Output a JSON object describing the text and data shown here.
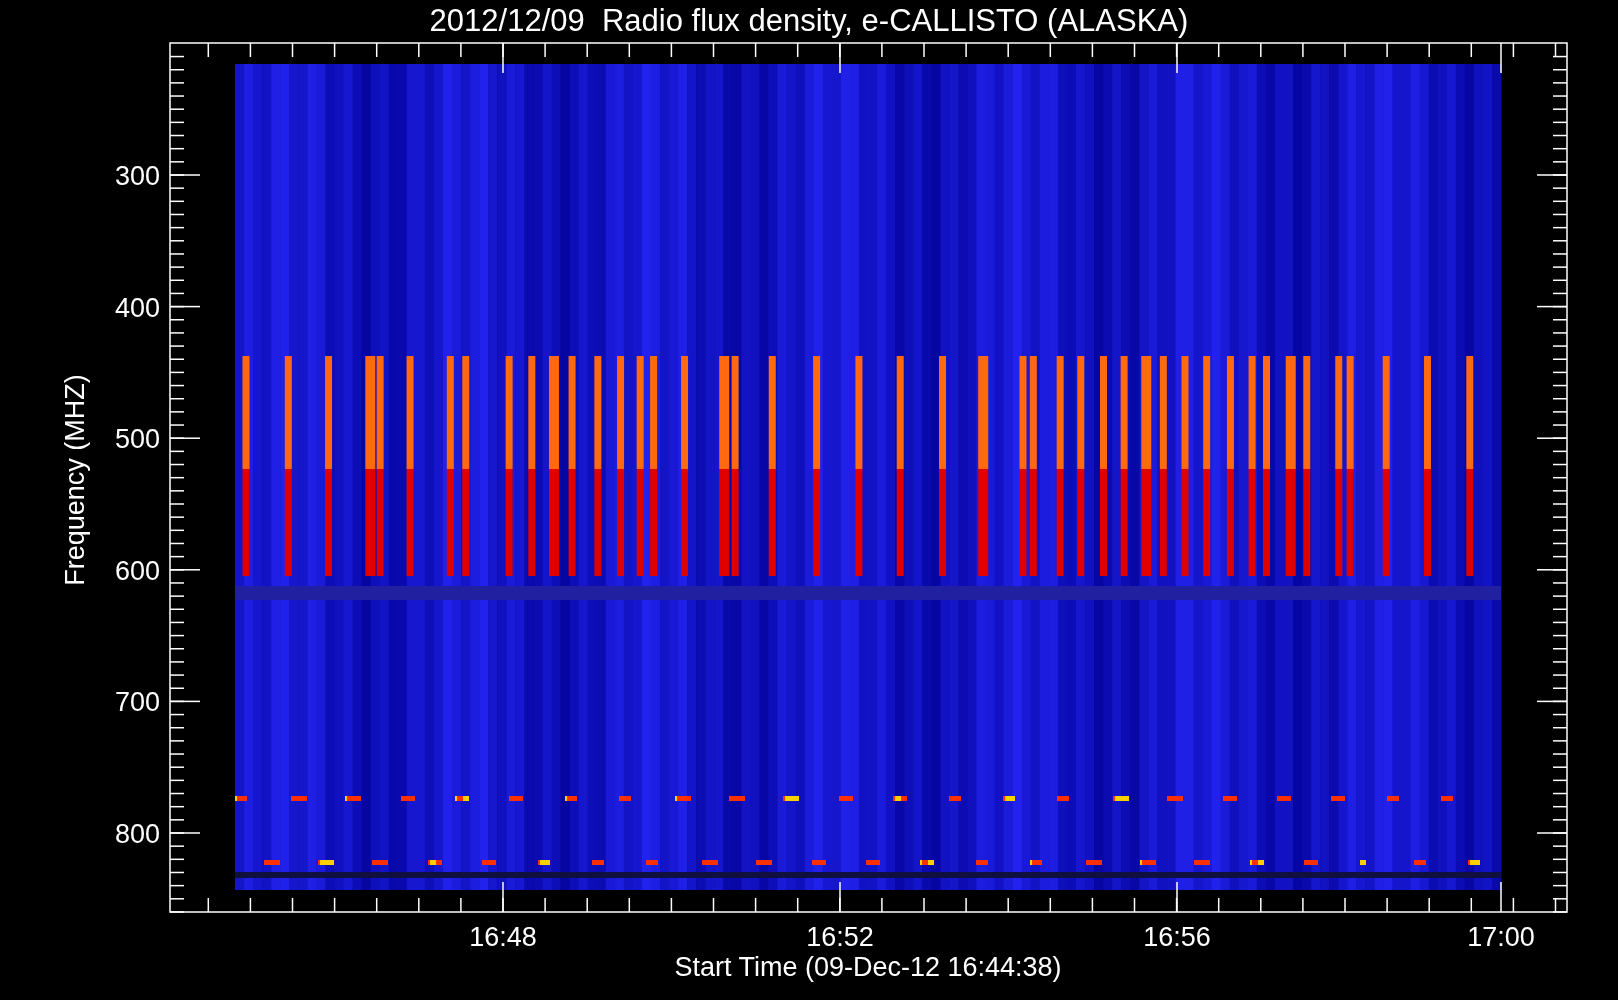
{
  "title": "2012/12/09  Radio flux density, e-CALLISTO (ALASKA)",
  "x_axis": {
    "label": "Start Time (09-Dec-12 16:44:38)",
    "ticks": [
      "16:48",
      "16:52",
      "16:56",
      "17:00"
    ]
  },
  "y_axis": {
    "label": "Frequency (MHZ)",
    "ticks": [
      "300",
      "400",
      "500",
      "600",
      "700",
      "800"
    ]
  }
}
